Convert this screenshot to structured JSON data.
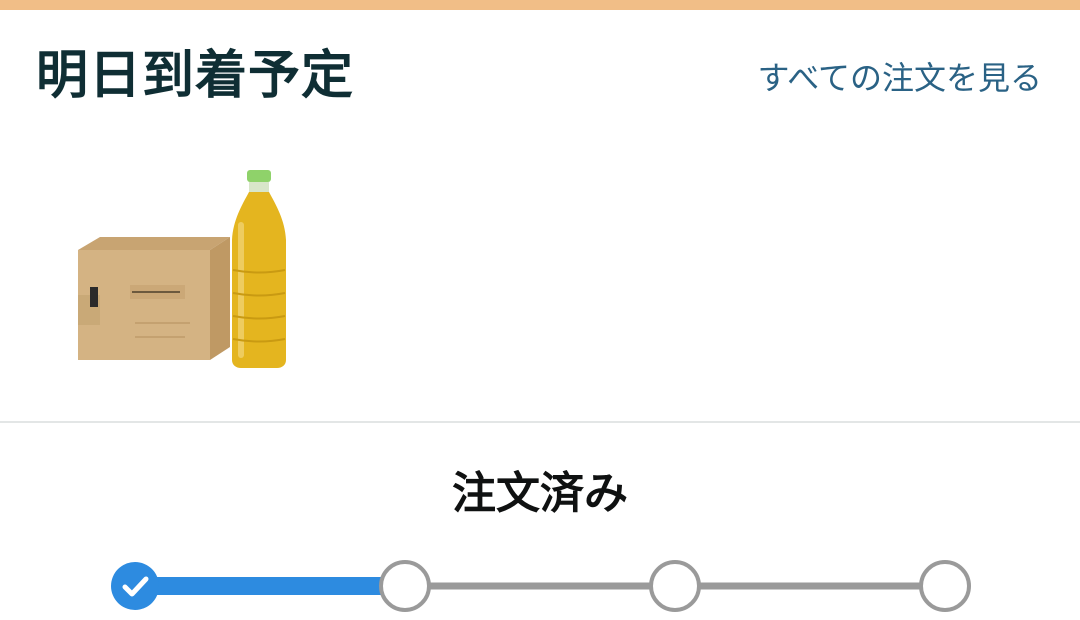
{
  "header": {
    "title": "明日到着予定",
    "view_all_label": "すべての注文を見る"
  },
  "product": {
    "icon": "green-tea-case-with-bottle-icon"
  },
  "status": {
    "label": "注文済み",
    "steps_total": 4,
    "steps_completed": 1,
    "completed_step_icon": "check-icon"
  },
  "colors": {
    "top_strip": "#f1be87",
    "title": "#0f2e34",
    "link": "#2a6285",
    "progress_active": "#2d8be0",
    "progress_inactive": "#9a9a9a",
    "divider": "#e3e6e6"
  }
}
